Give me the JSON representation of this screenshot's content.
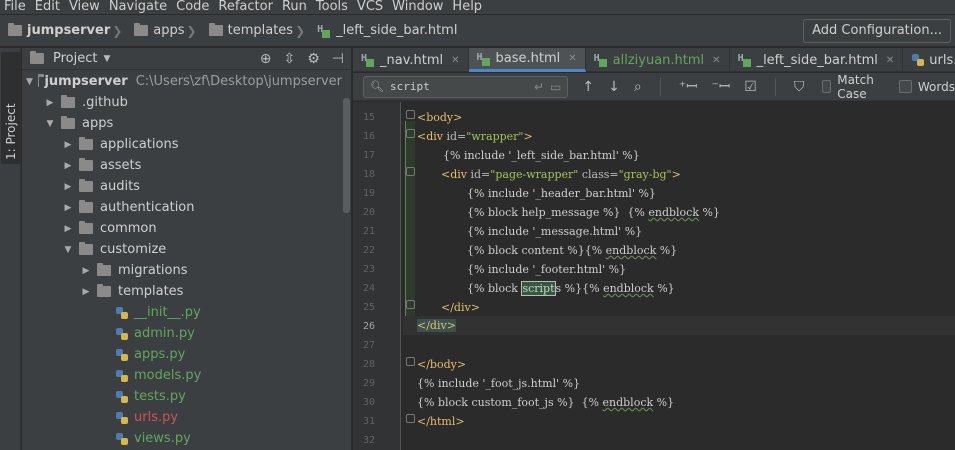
{
  "menu": [
    "File",
    "Edit",
    "View",
    "Navigate",
    "Code",
    "Refactor",
    "Run",
    "Tools",
    "VCS",
    "Window",
    "Help"
  ],
  "breadcrumb": [
    "jumpserver",
    "apps",
    "templates",
    "_left_side_bar.html"
  ],
  "add_config": "Add Configuration...",
  "toolwindow_tab": "1: Project",
  "project_panel": {
    "title": "Project",
    "root_name": "jumpserver",
    "root_path": "C:\\Users\\zf\\Desktop\\jumpserver",
    "items": [
      {
        "label": ".github",
        "type": "folder",
        "expanded": false
      },
      {
        "label": "apps",
        "type": "folder",
        "expanded": true
      },
      {
        "label": "applications",
        "type": "folder",
        "expanded": false
      },
      {
        "label": "assets",
        "type": "folder",
        "expanded": false
      },
      {
        "label": "audits",
        "type": "folder",
        "expanded": false
      },
      {
        "label": "authentication",
        "type": "folder",
        "expanded": false
      },
      {
        "label": "common",
        "type": "folder",
        "expanded": false
      },
      {
        "label": "customize",
        "type": "folder",
        "expanded": true
      },
      {
        "label": "migrations",
        "type": "folder",
        "expanded": false
      },
      {
        "label": "templates",
        "type": "folder",
        "expanded": false
      },
      {
        "label": "__init__.py",
        "type": "py",
        "color": "#62a65b"
      },
      {
        "label": "admin.py",
        "type": "py",
        "color": "#62a65b"
      },
      {
        "label": "apps.py",
        "type": "py",
        "color": "#62a65b"
      },
      {
        "label": "models.py",
        "type": "py",
        "color": "#62a65b"
      },
      {
        "label": "tests.py",
        "type": "py",
        "color": "#62a65b"
      },
      {
        "label": "urls.py",
        "type": "py",
        "color": "#d25252"
      },
      {
        "label": "views.py",
        "type": "py",
        "color": "#62a65b"
      }
    ]
  },
  "tabs": [
    {
      "label": "_nav.html",
      "icon": "html",
      "active": false,
      "color": "#cfcfcf"
    },
    {
      "label": "base.html",
      "icon": "html",
      "active": true,
      "color": "#cfcfcf"
    },
    {
      "label": "allziyuan.html",
      "icon": "html",
      "active": false,
      "color": "#62a65b"
    },
    {
      "label": "_left_side_bar.html",
      "icon": "html",
      "active": false,
      "color": "#cfcfcf"
    },
    {
      "label": "urls.py",
      "icon": "py",
      "active": false,
      "color": "#cfcfcf"
    }
  ],
  "search": {
    "value": "script",
    "match_case": "Match Case",
    "words": "Words"
  },
  "code": {
    "line_numbers": [
      "15",
      "16",
      "17",
      "18",
      "19",
      "20",
      "21",
      "22",
      "23",
      "24",
      "25",
      "26",
      "27",
      "28",
      "29",
      "30",
      "31",
      "32"
    ],
    "current_line": "26",
    "l15_tag": "<body>",
    "l16_open": "<div ",
    "l16_attr": "id=",
    "l16_val": "\"wrapper\"",
    "l16_close": ">",
    "l17_text": "{% include '_left_side_bar.html' %}",
    "l18_open": "<div ",
    "l18_attr1": "id=",
    "l18_val1": "\"page-wrapper\"",
    "l18_attr2": " class=",
    "l18_val2": "\"gray-bg\"",
    "l18_close": ">",
    "l19_text": "{% include '_header_bar.html' %}",
    "l20_a": "{% block help_message %}  {% ",
    "l20_w": "endblock",
    "l20_b": " %}",
    "l21_text": "{% include '_message.html' %}",
    "l22_a": "{% block content %}{% ",
    "l22_w": "endblock",
    "l22_b": " %}",
    "l23_text": "{% include '_footer.html' %}",
    "l24_a": "{% block ",
    "l24_hl": "script",
    "l24_s": "s",
    "l24_mid": " %}{% ",
    "l24_w": "endblock",
    "l24_b": " %}",
    "l25_tag": "</div>",
    "l26_tag": "</div>",
    "l28_tag": "</body>",
    "l29_text": "{% include '_foot_js.html' %}",
    "l30_a": "{% block custom_foot_js %}  {% ",
    "l30_w": "endblock",
    "l30_b": " %}",
    "l31_tag": "</html>"
  }
}
